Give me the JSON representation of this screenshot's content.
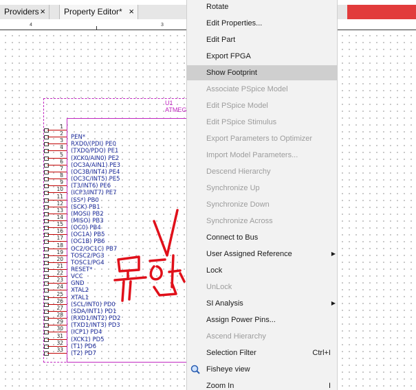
{
  "tabs": [
    {
      "label": "Providers",
      "close": "×"
    },
    {
      "label": "Property Editor*",
      "close": "×"
    }
  ],
  "ruler": [
    "4",
    "3"
  ],
  "part": {
    "ref": "U1",
    "value": "ATMEG",
    "pins": [
      {
        "num": "1",
        "name": ""
      },
      {
        "num": "2",
        "name": "PEN*"
      },
      {
        "num": "3",
        "name": "RXD0/(PDI) PE0"
      },
      {
        "num": "4",
        "name": "(TXD0/PDO) PE1"
      },
      {
        "num": "5",
        "name": "(XCK0/AIN0) PE2"
      },
      {
        "num": "6",
        "name": "(OC3A/AIN1) PE3"
      },
      {
        "num": "7",
        "name": "(OC3B/INT4) PE4"
      },
      {
        "num": "8",
        "name": "(OC3C/INT5) PE5"
      },
      {
        "num": "9",
        "name": "(T3/INT6) PE6"
      },
      {
        "num": "10",
        "name": "(ICP3/INT7) PE7"
      },
      {
        "num": "11",
        "name": "(SS*) PB0"
      },
      {
        "num": "12",
        "name": "(SCK) PB1"
      },
      {
        "num": "13",
        "name": "(MOSI) PB2"
      },
      {
        "num": "14",
        "name": "(MISO) PB3"
      },
      {
        "num": "15",
        "name": "(OC0) PB4"
      },
      {
        "num": "16",
        "name": "(OC1A) PB5"
      },
      {
        "num": "17",
        "name": "(OC1B) PB6"
      },
      {
        "num": "18",
        "name": "OC2/OC1C) PB7"
      },
      {
        "num": "19",
        "name": "TOSC2/PG3"
      },
      {
        "num": "20",
        "name": "TOSC1/PG4"
      },
      {
        "num": "21",
        "name": "RESET*"
      },
      {
        "num": "22",
        "name": "VCC"
      },
      {
        "num": "23",
        "name": "GND"
      },
      {
        "num": "24",
        "name": "XTAL2"
      },
      {
        "num": "25",
        "name": "XTAL1"
      },
      {
        "num": "26",
        "name": "(SCL/INT0) PD0"
      },
      {
        "num": "27",
        "name": "(SDA/INT1) PD1"
      },
      {
        "num": "28",
        "name": "(RXD1/INT2) PD2"
      },
      {
        "num": "29",
        "name": "(TXD1/INT3) PD3"
      },
      {
        "num": "30",
        "name": "(ICP1) PD4"
      },
      {
        "num": "31",
        "name": "(XCK1) PD5"
      },
      {
        "num": "32",
        "name": "(T1) PD6"
      },
      {
        "num": "33",
        "name": "(T2) PD7"
      }
    ]
  },
  "annotations": {
    "check": "V",
    "handwriting": "무한",
    "color": "#e0101a"
  },
  "menu": {
    "items": [
      {
        "label": "Rotate",
        "enabled": true
      },
      {
        "label": "Edit Properties...",
        "enabled": true
      },
      {
        "label": "Edit Part",
        "enabled": true
      },
      {
        "label": "Export FPGA",
        "enabled": true
      },
      {
        "label": "Show Footprint",
        "enabled": true,
        "highlighted": true
      },
      {
        "label": "Associate PSpice Model",
        "enabled": false
      },
      {
        "label": "Edit PSpice Model",
        "enabled": false
      },
      {
        "label": "Edit PSpice Stimulus",
        "enabled": false
      },
      {
        "label": "Export Parameters to Optimizer",
        "enabled": false
      },
      {
        "label": "Import Model Parameters...",
        "enabled": false
      },
      {
        "label": "Descend Hierarchy",
        "enabled": false
      },
      {
        "label": "Synchronize Up",
        "enabled": false
      },
      {
        "label": "Synchronize Down",
        "enabled": false
      },
      {
        "label": "Synchronize Across",
        "enabled": false
      },
      {
        "label": "Connect to Bus",
        "enabled": true
      },
      {
        "label": "User Assigned Reference",
        "enabled": true,
        "submenu": "▶"
      },
      {
        "label": "Lock",
        "enabled": true
      },
      {
        "label": "UnLock",
        "enabled": false
      },
      {
        "label": "SI Analysis",
        "enabled": true,
        "submenu": "▶"
      },
      {
        "label": "Assign Power Pins...",
        "enabled": true
      },
      {
        "label": "Ascend Hierarchy",
        "enabled": false
      },
      {
        "label": "Selection Filter",
        "enabled": true,
        "shortcut": "Ctrl+I"
      },
      {
        "label": "Fisheye view",
        "enabled": true,
        "icon": "fisheye-icon"
      },
      {
        "label": "Zoom In",
        "enabled": true,
        "shortcut": "I"
      }
    ]
  }
}
